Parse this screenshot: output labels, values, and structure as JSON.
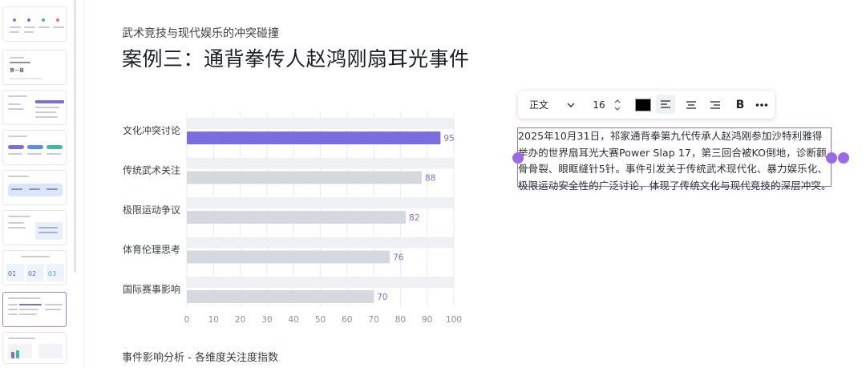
{
  "slide": {
    "subtitle": "武术竞技与现代娱乐的冲突碰撞",
    "title": "案例三：通背拳传人赵鸿刚扇耳光事件",
    "chart_caption": "事件影响分析 - 各维度关注度指数"
  },
  "chart_data": {
    "type": "bar",
    "orientation": "horizontal",
    "categories": [
      "文化冲突讨论",
      "传统武术关注",
      "极限运动争议",
      "体育伦理思考",
      "国际赛事影响"
    ],
    "values": [
      95,
      88,
      82,
      76,
      70
    ],
    "xlim": [
      0,
      100
    ],
    "xticks": [
      0,
      10,
      20,
      30,
      40,
      50,
      60,
      70,
      80,
      90,
      100
    ],
    "grid": true,
    "highlight_color": "#7b6de0",
    "bar_color": "#d5d8de",
    "track_color": "#eef0f3"
  },
  "toolbar": {
    "paragraph_style": "正文",
    "font_size": "16",
    "text_color": "#000000",
    "bold_label": "B",
    "icons": [
      "chevron-down-icon",
      "stepper-icon",
      "align-left-icon",
      "align-center-icon",
      "align-right-icon",
      "more-icon"
    ]
  },
  "textbox": {
    "content": "2025年10月31日，祁家通背拳第九代传承人赵鸿刚参加沙特利雅得举办的世界扇耳光大赛Power Slap 17，第三回合被KO倒地，诊断颧骨骨裂、眼眶缝针5针。事件引发关于传统武术现代化、暴力娱乐化、极限运动安全性的广泛讨论，体现了传统文化与现代竞技的深层冲突。",
    "border_color": "#8a79d8"
  },
  "thumbnails": {
    "active_index": 7,
    "slide2_heading": "第一章",
    "steps": [
      "01",
      "02",
      "03"
    ]
  }
}
